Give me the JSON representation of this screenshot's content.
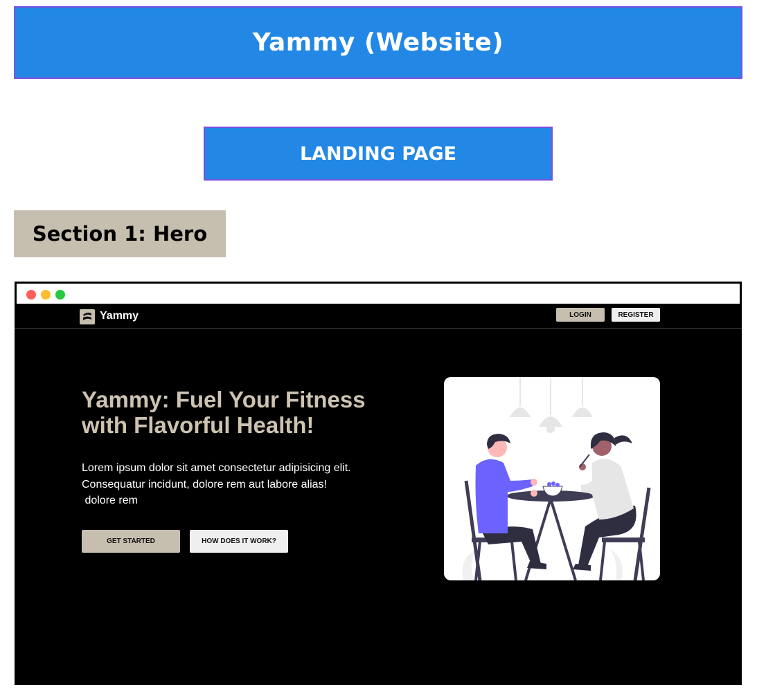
{
  "header": {
    "title": "Yammy (Website)",
    "subtitle": "LANDING PAGE",
    "section_label": "Section 1: Hero"
  },
  "browser": {
    "window_controls": [
      "close",
      "minimize",
      "maximize"
    ],
    "nav": {
      "brand": "Yammy",
      "login_label": "LOGIN",
      "register_label": "REGISTER"
    },
    "hero": {
      "heading": "Yammy: Fuel Your Fitness with Flavorful Health!",
      "description_lines": [
        "Lorem ipsum dolor sit amet consectetur adipisicing elit.",
        "Consequatur incidunt, dolore rem aut labore alias!",
        " dolore rem"
      ],
      "primary_button": "GET STARTED",
      "secondary_button": "HOW DOES IT WORK?"
    }
  },
  "colors": {
    "banner_blue": "#2387e5",
    "banner_border": "#7a4fe0",
    "beige": "#c6bfaf",
    "heading_beige": "#cdc3b1",
    "background": "#000000",
    "light_button": "#efefef",
    "accent_purple": "#6c63ff"
  },
  "icons": {
    "logo": "yammy-logo-icon",
    "illustration": "two-people-dining-illustration"
  }
}
